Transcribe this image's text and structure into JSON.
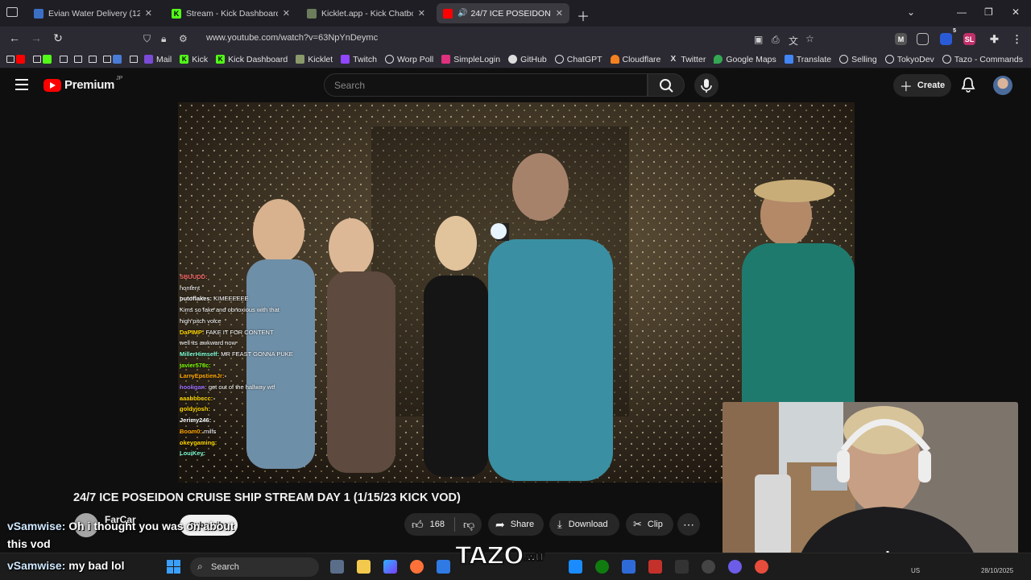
{
  "browser": {
    "tabs": [
      {
        "title": "Evian Water Delivery (12 or 24 B",
        "icon": "evian-icon",
        "color": "#3b6fc4",
        "active": false
      },
      {
        "title": "Stream - Kick Dashboard",
        "icon": "kick-icon",
        "color": "#53fc18",
        "active": false
      },
      {
        "title": "Kicklet.app - Kick Chatbot and C",
        "icon": "kicklet-icon",
        "color": "#6b7d5a",
        "active": false
      },
      {
        "title": "24/7 ICE POSEIDON CRUISE",
        "icon": "youtube-icon",
        "color": "#ff0000",
        "active": true
      }
    ],
    "url": "www.youtube.com/watch?v=63NpYnDeymc",
    "bookmarks": [
      {
        "label": "Mail",
        "icon": "mail-icon",
        "color": "#7b4bd6"
      },
      {
        "label": "Kick",
        "icon": "kick-icon",
        "color": "#53fc18"
      },
      {
        "label": "Kick Dashboard",
        "icon": "kick-icon",
        "color": "#53fc18"
      },
      {
        "label": "Kicklet",
        "icon": "kicklet-icon",
        "color": "#8a9a6a"
      },
      {
        "label": "Twitch",
        "icon": "twitch-icon",
        "color": "#9146ff"
      },
      {
        "label": "Worp Poll",
        "icon": "globe-icon",
        "color": "#dddddd"
      },
      {
        "label": "SimpleLogin",
        "icon": "simplelogin-icon",
        "color": "#e0317e"
      },
      {
        "label": "GitHub",
        "icon": "github-icon",
        "color": "#dddddd"
      },
      {
        "label": "ChatGPT",
        "icon": "chatgpt-icon",
        "color": "#dddddd"
      },
      {
        "label": "Cloudflare",
        "icon": "cloudflare-icon",
        "color": "#f48120"
      },
      {
        "label": "Twitter",
        "icon": "x-icon",
        "color": "#dddddd"
      },
      {
        "label": "Google Maps",
        "icon": "maps-icon",
        "color": "#34a853"
      },
      {
        "label": "Translate",
        "icon": "translate-icon",
        "color": "#4285f4"
      },
      {
        "label": "Selling",
        "icon": "globe-icon",
        "color": "#dddddd"
      },
      {
        "label": "TokyoDev",
        "icon": "globe-icon",
        "color": "#dddddd"
      },
      {
        "label": "Tazo - Commands",
        "icon": "globe-icon",
        "color": "#dddddd"
      }
    ],
    "extension_badge": "5"
  },
  "youtube": {
    "logo_text": "Premium",
    "logo_region": "JP",
    "search_placeholder": "Search",
    "create_label": "Create",
    "video_title": "24/7 ICE POSEIDON CRUISE SHIP STREAM DAY 1 (1/15/23 KICK VOD)",
    "channel": "FarCar",
    "subscribe_label": "Subscribe",
    "likes": "168",
    "share_label": "Share",
    "download_label": "Download",
    "clip_label": "Clip"
  },
  "stream_chat": [
    {
      "user": "SBUUDD:",
      "msg": "",
      "color": "#ff6b6b"
    },
    {
      "user": "",
      "msg": "nontent",
      "color": "#b03030"
    },
    {
      "user": "putoflakes:",
      "msg": "KIMEEEEEE",
      "color": "#ffffff"
    },
    {
      "user": "",
      "msg": "Kims so fake and obnoxious with that",
      "color": "#a070ff"
    },
    {
      "user": "",
      "msg": "high pitch voice",
      "color": "#ffffff"
    },
    {
      "user": "DaPIMP:",
      "msg": "FAKE IT FOR CONTENT",
      "color": "#ffd700"
    },
    {
      "user": "",
      "msg": "well its awkward now",
      "color": "#ff4040"
    },
    {
      "user": "MillerHimself:",
      "msg": "MR FEAST GONNA PUKE",
      "color": "#7fffd4"
    },
    {
      "user": "javier578c:",
      "msg": "",
      "color": "#7cfc00"
    },
    {
      "user": "LarryEpstienJr:",
      "msg": "",
      "color": "#ffa500"
    },
    {
      "user": "hooligan:",
      "msg": "get out of the hallway wtf",
      "color": "#a070ff"
    },
    {
      "user": "aaabbbccc:",
      "msg": "",
      "color": "#ffd700"
    },
    {
      "user": "",
      "msg": "",
      "color": "#ff4040"
    },
    {
      "user": "goldyjosh:",
      "msg": "",
      "color": "#ffd700"
    },
    {
      "user": "Jerimy246:",
      "msg": "",
      "color": "#ffffff"
    },
    {
      "user": "Boom0:",
      "msg": "milfs",
      "color": "#ffa500"
    },
    {
      "user": "okeygaming:",
      "msg": "",
      "color": "#ffd700"
    },
    {
      "user": "LouiKey:",
      "msg": "",
      "color": "#7fffd4"
    }
  ],
  "overlay_chat": [
    {
      "user": "vSamwise:",
      "msg": "Oh i thought you was on about"
    },
    {
      "user": "",
      "msg": "this vod"
    },
    {
      "user": "vSamwise:",
      "msg": "my bad lol"
    }
  ],
  "watermark": {
    "main": "TAZO",
    "suffix": ".wtf"
  },
  "taskbar": {
    "search_label": "Search",
    "date": "28/10/2025",
    "lang": "US"
  }
}
